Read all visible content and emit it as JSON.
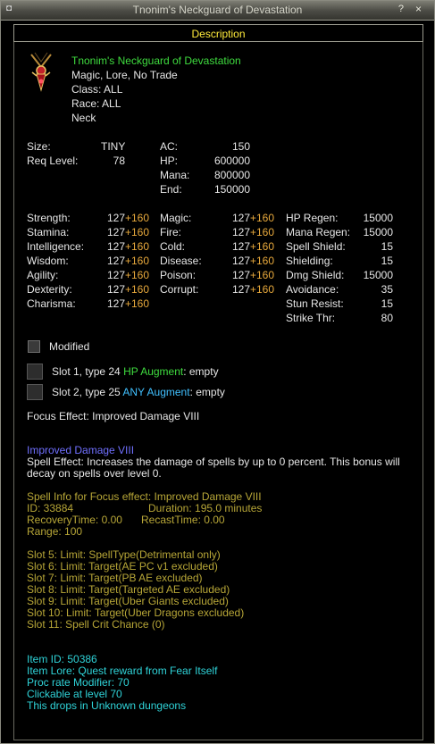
{
  "window": {
    "title": "Tnonim's Neckguard of Devastation",
    "help": "?",
    "close": "×"
  },
  "tab": "Description",
  "item": {
    "name": "Tnonim's Neckguard of Devastation",
    "flags": "Magic, Lore, No Trade",
    "class": "Class:  ALL",
    "race": "Race:  ALL",
    "slot": "Neck"
  },
  "basic": {
    "size_label": "Size:",
    "size_value": "TINY",
    "req_label": "Req Level:",
    "req_value": "78",
    "ac_label": "AC:",
    "ac_value": "150",
    "hp_label": "HP:",
    "hp_value": "600000",
    "mana_label": "Mana:",
    "mana_value": "800000",
    "end_label": "End:",
    "end_value": "150000"
  },
  "stats": [
    {
      "label": "Strength:",
      "base": "127",
      "bonus": "+160"
    },
    {
      "label": "Stamina:",
      "base": "127",
      "bonus": "+160"
    },
    {
      "label": "Intelligence:",
      "base": "127",
      "bonus": "+160"
    },
    {
      "label": "Wisdom:",
      "base": "127",
      "bonus": "+160"
    },
    {
      "label": "Agility:",
      "base": "127",
      "bonus": "+160"
    },
    {
      "label": "Dexterity:",
      "base": "127",
      "bonus": "+160"
    },
    {
      "label": "Charisma:",
      "base": "127",
      "bonus": "+160"
    }
  ],
  "resists": [
    {
      "label": "Magic:",
      "base": "127",
      "bonus": "+160"
    },
    {
      "label": "Fire:",
      "base": "127",
      "bonus": "+160"
    },
    {
      "label": "Cold:",
      "base": "127",
      "bonus": "+160"
    },
    {
      "label": "Disease:",
      "base": "127",
      "bonus": "+160"
    },
    {
      "label": "Poison:",
      "base": "127",
      "bonus": "+160"
    },
    {
      "label": "Corrupt:",
      "base": "127",
      "bonus": "+160"
    }
  ],
  "mods": [
    {
      "label": "HP Regen:",
      "value": "15000"
    },
    {
      "label": "Mana Regen:",
      "value": "15000"
    },
    {
      "label": "Spell Shield:",
      "value": "15"
    },
    {
      "label": "Shielding:",
      "value": "15"
    },
    {
      "label": "Dmg Shield:",
      "value": "15000"
    },
    {
      "label": "Avoidance:",
      "value": "35"
    },
    {
      "label": "Stun Resist:",
      "value": "15"
    },
    {
      "label": "Strike Thr:",
      "value": "80"
    }
  ],
  "modified_label": "Modified",
  "slots": [
    {
      "prefix": "Slot 1, type 24 ",
      "aug": "HP Augment",
      "suffix": ": empty"
    },
    {
      "prefix": "Slot 2, type 25 ",
      "aug": "ANY Augment",
      "suffix": ": empty"
    }
  ],
  "focus_effect": "Focus Effect: Improved Damage VIII",
  "spell": {
    "name": "Improved Damage VIII",
    "effect_line1": "Spell Effect: Increases the damage of spells by up to 0 percent. This bonus will",
    "effect_line2": "decay on spells over level 0.",
    "info_header": "Spell Info for Focus effect: Improved Damage VIII",
    "id": "ID: 33884",
    "duration": "Duration: 195.0 minutes",
    "recovery": "RecoveryTime: 0.00",
    "recast": "RecastTime: 0.00",
    "range": "Range: 100",
    "limits": [
      "Slot 5: Limit: SpellType(Detrimental only)",
      "Slot 6: Limit: Target(AE PC v1 excluded)",
      "Slot 7: Limit: Target(PB AE excluded)",
      "Slot 8: Limit: Target(Targeted AE excluded)",
      "Slot 9: Limit: Target(Uber Giants excluded)",
      "Slot 10: Limit: Target(Uber Dragons excluded)",
      "Slot 11: Spell Crit Chance (0)"
    ]
  },
  "footer": [
    "Item ID: 50386",
    "Item Lore: Quest reward from Fear Itself",
    "Proc rate Modifier: 70",
    "Clickable at level 70",
    "This drops in Unknown dungeons"
  ]
}
